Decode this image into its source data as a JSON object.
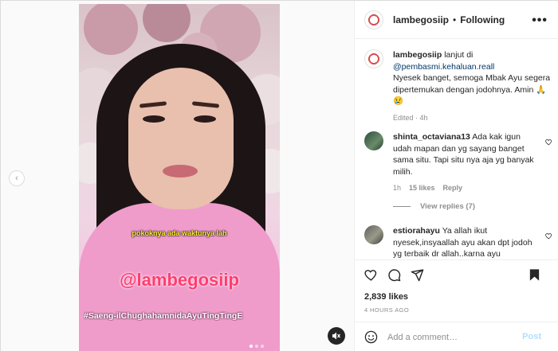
{
  "post": {
    "username": "lambegosiip",
    "separator": "•",
    "follow_status": "Following",
    "more_label": "•••",
    "caption": {
      "username": "lambegosiip",
      "prefix": "lanjut di",
      "mention": "@pembasmi.kehaluan.reall",
      "text": "Nyesek banget, semoga Mbak Ayu segera dipertemukan dengan jodohnya. Amin 🙏😢",
      "edited": "Edited",
      "age": "4h"
    },
    "likes": "2,839 likes",
    "timestamp": "4 HOURS AGO"
  },
  "media": {
    "subtitle": "pokoknya ada waktunya lah",
    "watermark": "@lambegosiip",
    "hashtag": "#Saeng-ilChughahamnidaAyuTingTingE",
    "prev_arrow": "‹",
    "carousel_active_index": 0,
    "carousel_count": 3
  },
  "comments": [
    {
      "username": "shinta_octaviana13",
      "text": "Ada kak igun udah mapan dan yg sayang banget sama situ. Tapi situ nya aja yg banyak milih.",
      "age": "1h",
      "likes": "15 likes",
      "reply_label": "Reply"
    },
    {
      "username": "estiorahayu",
      "text": "Ya allah ikut nyesek,insyaallah ayu akan dpt jodoh yg terbaik dr allah..karna ayu"
    }
  ],
  "view_replies": "View replies (7)",
  "composer": {
    "placeholder": "Add a comment…",
    "post_label": "Post"
  },
  "colors": {
    "accent_link": "#00376b",
    "post_button_disabled": "#b2dffc",
    "watermark": "#ff3c6e",
    "subtitle": "#ffef3a"
  },
  "icons": [
    "heart-icon",
    "comment-icon",
    "share-icon",
    "bookmark-icon",
    "smiley-icon",
    "mute-icon",
    "chevron-left-icon",
    "more-icon"
  ]
}
